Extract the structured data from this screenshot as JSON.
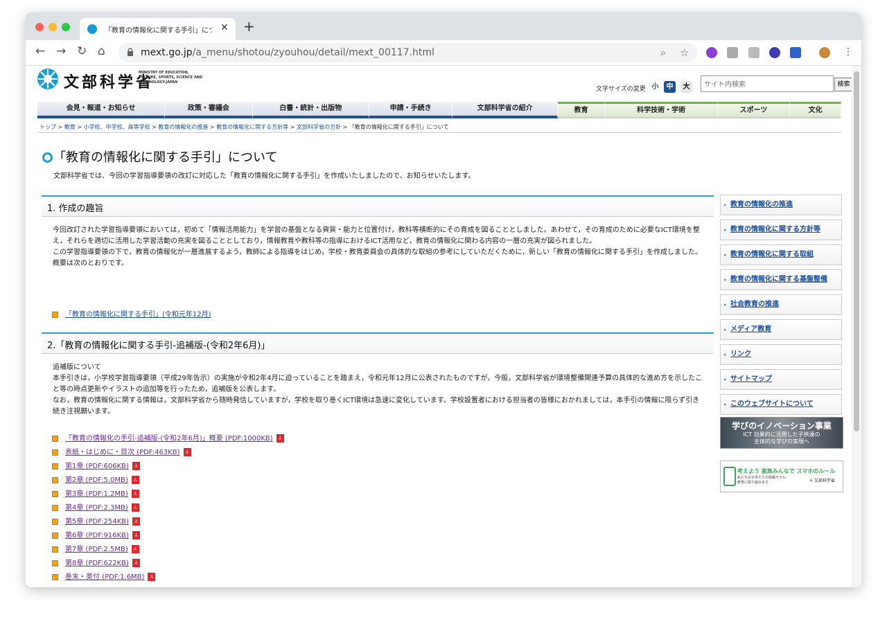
{
  "browser": {
    "tab_title": "「教育の情報化に関する手引」について",
    "tab_close": "✕",
    "new_tab": "+",
    "url_host": "mext.go.jp",
    "url_path": "/a_menu/shotou/zyouhou/detail/mext_00117.html"
  },
  "header": {
    "logo_jp": "文部科学省",
    "logo_en": "MINISTRY OF EDUCATION, CULTURE, SPORTS, SCIENCE AND TECHNOLOGY-JAPAN",
    "font_size_label": "文字サイズの変更",
    "font_sizes": [
      "小",
      "中",
      "大"
    ],
    "search_placeholder": "サイト内検索",
    "search_button": "検索"
  },
  "gnav": [
    {
      "label": "会見・報道・お知らせ"
    },
    {
      "label": "政策・審議会"
    },
    {
      "label": "白書・統計・出版物"
    },
    {
      "label": "申請・手続き"
    },
    {
      "label": "文部科学省の紹介"
    },
    {
      "label": "教育"
    },
    {
      "label": "科学技術・学術"
    },
    {
      "label": "スポーツ"
    },
    {
      "label": "文化"
    }
  ],
  "breadcrumb": [
    "トップ",
    "教育",
    "小学校、中学校、高等学校",
    "教育の情報化の推進",
    "教育の情報化に関する方針等",
    "文部科学省の方針",
    "「教育の情報化に関する手引」について"
  ],
  "page": {
    "title": "「教育の情報化に関する手引」について",
    "lead": "文部科学省では、今回の学習指導要領の改訂に対応した「教育の情報化に関する手引」を作成いたしましたので、お知らせいたします。",
    "section1": {
      "heading": "1. 作成の趣旨",
      "p1": "今回改訂された学習指導要領においては，初めて「情報活用能力」を学習の基盤となる資質・能力と位置付け，教科等横断的にその育成を図ることとしました。あわせて，その育成のために必要なICT環境を整え，それらを適切に活用した学習活動の充実を図ることとしており，情報教育や教科等の指導におけるICT活用など，教育の情報化に関わる内容の一層の充実が図られました。",
      "p2": "この学習指導要領の下で，教育の情報化が一層進展するよう，教師による指導をはじめ，学校・教育委員会の具体的な取組の参考にしていただくために，新しい「教育の情報化に関する手引」を作成しました。",
      "p3": "概要は次のとおりです。",
      "link": "「教育の情報化に関する手引」(令和元年12月)"
    },
    "section2": {
      "heading": "2.「教育の情報化に関する手引-追補版-(令和2年6月)」",
      "p1": "追補版について",
      "p2": "本手引きは，小学校学習指導要領（平成29年告示）の実施が令和2年4月に迫っていることを踏まえ，令和元年12月に公表されたものですが，今般，文部科学省が環境整備関連予算の具体的な進め方を示したこと等の時点更新やイラストの追加等を行ったため，追補版を公表します。",
      "p3": "なお，教育の情報化に関する情報は，文部科学省から随時発信していますが，学校を取り巻くICT環境は急速に変化しています。学校設置者における担当者の皆様におかれましては，本手引の情報に限らず引き続き注視願います。",
      "links": [
        {
          "label": "「教育の情報化の手引-追補版-(令和2年6月)」概要 (PDF:1000KB)"
        },
        {
          "label": "表紙・はじめに・目次 (PDF:463KB)"
        },
        {
          "label": "第1章 (PDF:606KB)"
        },
        {
          "label": "第2章 (PDF:5.0MB)"
        },
        {
          "label": "第3章 (PDF:1.2MB)"
        },
        {
          "label": "第4章 (PDF:2.3MB)"
        },
        {
          "label": "第5章 (PDF:254KB)"
        },
        {
          "label": "第6章 (PDF:916KB)"
        },
        {
          "label": "第7章 (PDF:2.5MB)"
        },
        {
          "label": "第8章 (PDF:622KB)"
        },
        {
          "label": "巻末・奥付 (PDF:1.6MB)"
        }
      ]
    }
  },
  "sidebar": [
    "教育の情報化の推進",
    "教育の情報化に関する方針等",
    "教育の情報化に関する取組",
    "教育の情報化に関する基盤整備",
    "社会教育の推進",
    "メディア教育",
    "リンク",
    "サイトマップ",
    "このウェブサイトについて"
  ],
  "banners": {
    "b1_title": "学びのイノベーション事業",
    "b1_line1": "ICT 効果的に活用した子供達の",
    "b1_line2": "主体的な学びの実現へ",
    "b2_title": "考えよう 家族みんなで スマホのルール",
    "b2_sub": "私たちの子供たちの情報モラル教育に取り組みます",
    "b2_logo": "✕ 文部科学省"
  },
  "colors": {
    "accent": "#22a6cf",
    "nav_blue": "#1e4f9a",
    "nav_green": "#6bb92d",
    "link": "#1a4f9c",
    "bullet": "#f0a41d",
    "pdf": "#e0282e"
  }
}
